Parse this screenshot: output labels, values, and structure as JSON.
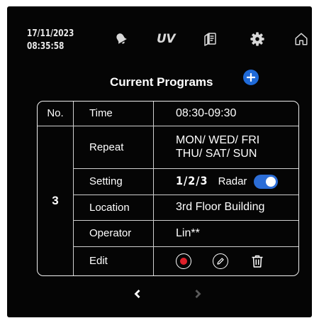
{
  "status": {
    "date": "17/11/2023",
    "time": "08:35:58"
  },
  "top_icons": [
    {
      "name": "bell-icon"
    },
    {
      "name": "uv-icon",
      "text": "UV"
    },
    {
      "name": "document-list-icon"
    },
    {
      "name": "gear-icon"
    },
    {
      "name": "home-icon"
    }
  ],
  "header": {
    "title": "Current Programs",
    "add_icon": "plus-icon"
  },
  "table": {
    "headers": {
      "no": "No.",
      "time": "Time"
    },
    "program_no": "3",
    "time_value": "08:30-09:30",
    "rows": {
      "repeat": {
        "label": "Repeat",
        "line1": "MON/ WED/ FRI",
        "line2": "THU/ SAT/ SUN"
      },
      "setting": {
        "label": "Setting",
        "levels": "1/2/3",
        "radar_label": "Radar",
        "radar_on": true
      },
      "location": {
        "label": "Location",
        "value": "3rd Floor Building"
      },
      "operator": {
        "label": "Operator",
        "value": "Lin**"
      },
      "edit": {
        "label": "Edit",
        "icons": [
          "record-icon",
          "pencil-icon",
          "trash-icon"
        ]
      }
    }
  },
  "pagination": {
    "prev_icon": "chevron-left-icon",
    "next_icon": "chevron-right-icon",
    "next_enabled": false
  },
  "colors": {
    "accent": "#2c6dd6",
    "record_red": "#e0202a",
    "background": "#050505"
  }
}
